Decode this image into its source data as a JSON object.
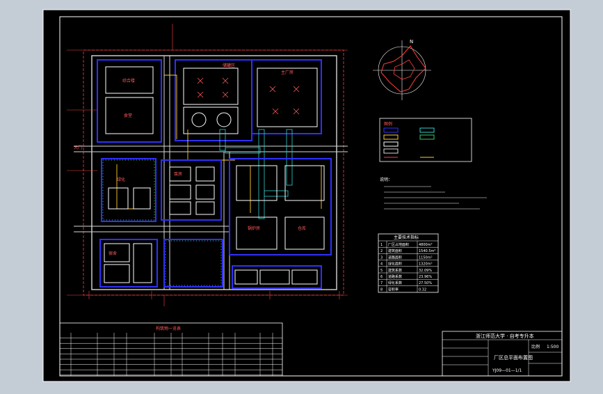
{
  "colors": {
    "background": "#c4ccd6",
    "sheet": "#000000",
    "frame": "#ffffff",
    "road": "#d8d8d8",
    "building": "#ffffff",
    "zone": "#3030ff",
    "dim": "#ff4040",
    "pipe": "#ffcc33",
    "green": "#33cc66",
    "cyan": "#33cccc",
    "label": "#ff5a5a"
  },
  "sheet_title": {
    "org": "浙江师范大学 · 自考专升本",
    "drawing": "厂区总平面布置图",
    "scale_label": "比例",
    "scale_value": "1:500",
    "number": "YJ09—01—1/1"
  },
  "north": {
    "label": "N"
  },
  "legend": {
    "title": "图例"
  },
  "notes": {
    "title": "说明："
  },
  "tech": {
    "title": "主要技术指标",
    "rows": [
      [
        "1",
        "厂区占地面积",
        "4800m²"
      ],
      [
        "2",
        "建筑面积",
        "1540.5m²"
      ],
      [
        "3",
        "道路面积",
        "1150m²"
      ],
      [
        "4",
        "绿化面积",
        "1320m²"
      ],
      [
        "5",
        "建筑系数",
        "32.09%"
      ],
      [
        "6",
        "道路系数",
        "23.96%"
      ],
      [
        "7",
        "绿化系数",
        "27.50%"
      ],
      [
        "8",
        "容积率",
        "0.32"
      ]
    ]
  },
  "struct_table": {
    "title": "构筑物一览表"
  },
  "plan_labels": {
    "admin": "综合楼",
    "canteen": "食堂",
    "gate1": "大门",
    "dorm": "宿舍",
    "green_area": "绿化",
    "workshop": "主厂房",
    "pump": "泵房",
    "tank": "储罐区",
    "boiler": "锅炉房",
    "store": "仓库"
  }
}
